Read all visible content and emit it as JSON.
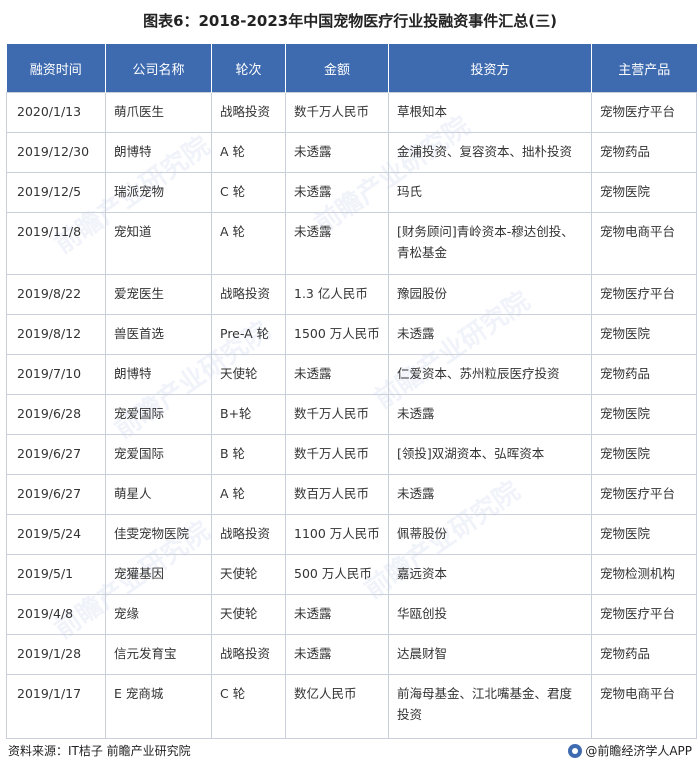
{
  "title": "图表6：2018-2023年中国宠物医疗行业投融资事件汇总(三)",
  "headers": [
    "融资时间",
    "公司名称",
    "轮次",
    "金额",
    "投资方",
    "主营产品"
  ],
  "rows": [
    [
      "2020/1/13",
      "萌爪医生",
      "战略投资",
      "数千万人民币",
      "草根知本",
      "宠物医疗平台"
    ],
    [
      "2019/12/30",
      "朗博特",
      "A 轮",
      "未透露",
      "金浦投资、复容资本、拙朴投资",
      "宠物药品"
    ],
    [
      "2019/12/5",
      "瑞派宠物",
      "C 轮",
      "未透露",
      "玛氏",
      "宠物医院"
    ],
    [
      "2019/11/8",
      "宠知道",
      "A 轮",
      "未透露",
      "[财务顾问]青岭资本-穆达创投、青松基金",
      "宠物电商平台"
    ],
    [
      "2019/8/22",
      "爱宠医生",
      "战略投资",
      "1.3 亿人民币",
      "豫园股份",
      "宠物医疗平台"
    ],
    [
      "2019/8/12",
      "兽医首选",
      "Pre-A 轮",
      "1500 万人民币",
      "未透露",
      "宠物医院"
    ],
    [
      "2019/7/10",
      "朗博特",
      "天使轮",
      "未透露",
      "仁爱资本、苏州粒辰医疗投资",
      "宠物药品"
    ],
    [
      "2019/6/28",
      "宠爱国际",
      "B+轮",
      "数千万人民币",
      "未透露",
      "宠物医院"
    ],
    [
      "2019/6/27",
      "宠爱国际",
      "B 轮",
      "数千万人民币",
      "[领投]双湖资本、弘晖资本",
      "宠物医院"
    ],
    [
      "2019/6/27",
      "萌星人",
      "A 轮",
      "数百万人民币",
      "未透露",
      "宠物医疗平台"
    ],
    [
      "2019/5/24",
      "佳雯宠物医院",
      "战略投资",
      "1100 万人民币",
      "佩蒂股份",
      "宠物医院"
    ],
    [
      "2019/5/1",
      "宠獾基因",
      "天使轮",
      "500 万人民币",
      "嘉远资本",
      "宠物检测机构"
    ],
    [
      "2019/4/8",
      "宠缘",
      "天使轮",
      "未透露",
      "华瓯创投",
      "宠物医疗平台"
    ],
    [
      "2019/1/28",
      "信元发育宝",
      "战略投资",
      "未透露",
      "达晨财智",
      "宠物药品"
    ],
    [
      "2019/1/17",
      "E 宠商城",
      "C 轮",
      "数亿人民币",
      "前海母基金、江北嘴基金、君度投资",
      "宠物电商平台"
    ]
  ],
  "footer": {
    "source": "资料来源：IT桔子 前瞻产业研究院",
    "brand": "@前瞻经济学人APP"
  },
  "watermark": "前瞻产业研究院",
  "colors": {
    "header_bg": "#3e6bb0",
    "border": "#c9d0da"
  }
}
